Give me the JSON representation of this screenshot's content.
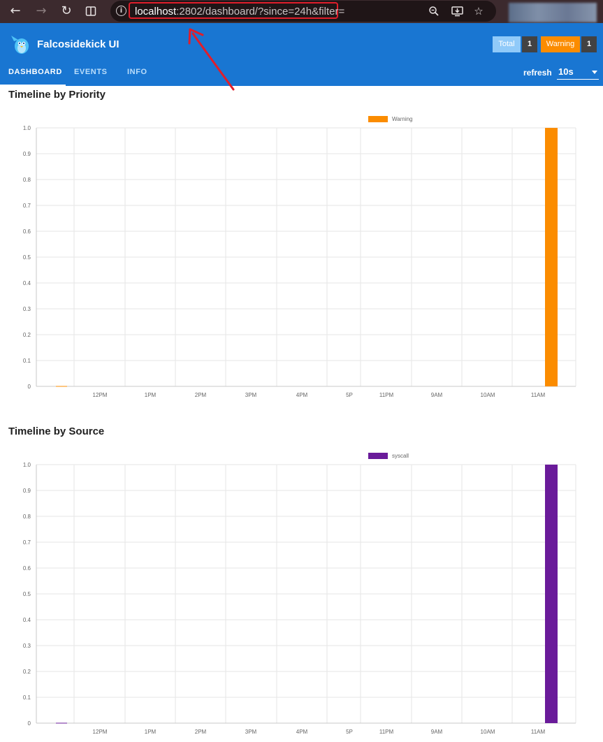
{
  "browser": {
    "url_host": "localhost",
    "url_rest": ":2802/dashboard/?since=24h&filter=",
    "back_icon": "arrow-left-icon",
    "forward_icon": "arrow-right-icon",
    "reload_icon": "reload-icon",
    "split_icon": "split-view-icon",
    "info_icon": "info-icon",
    "zoom_icon": "zoom-icon",
    "install_icon": "install-app-icon",
    "bookmark_icon": "star-icon"
  },
  "header": {
    "title": "Falcosidekick UI",
    "badges": {
      "total_label": "Total",
      "total_count": "1",
      "warning_label": "Warning",
      "warning_count": "1"
    },
    "tabs": [
      {
        "label": "DASHBOARD",
        "active": true
      },
      {
        "label": "EVENTS",
        "active": false
      },
      {
        "label": "INFO",
        "active": false
      }
    ],
    "refresh_label": "refresh",
    "refresh_value": "10s"
  },
  "chart_data": [
    {
      "type": "bar",
      "title": "Timeline by Priority",
      "categories": [
        "",
        "12PM",
        "1PM",
        "2PM",
        "3PM",
        "4PM",
        "5P",
        "11PM",
        "9AM",
        "10AM",
        "11AM",
        ""
      ],
      "series": [
        {
          "name": "Warning",
          "color": "#fb8c00",
          "values": [
            0,
            0,
            0,
            0,
            0,
            0,
            0,
            0,
            0,
            0,
            0,
            1
          ]
        }
      ],
      "ylim": [
        0,
        1.0
      ],
      "yticks": [
        "0",
        "0.1",
        "0.2",
        "0.3",
        "0.4",
        "0.5",
        "0.6",
        "0.7",
        "0.8",
        "0.9",
        "1.0"
      ],
      "grid": true,
      "legend": "top-center"
    },
    {
      "type": "bar",
      "title": "Timeline by Source",
      "categories": [
        "",
        "12PM",
        "1PM",
        "2PM",
        "3PM",
        "4PM",
        "5P",
        "11PM",
        "9AM",
        "10AM",
        "11AM",
        ""
      ],
      "series": [
        {
          "name": "syscall",
          "color": "#6a1b9a",
          "values": [
            0,
            0,
            0,
            0,
            0,
            0,
            0,
            0,
            0,
            0,
            0,
            1
          ]
        }
      ],
      "ylim": [
        0,
        1.0
      ],
      "yticks": [
        "0",
        "0.1",
        "0.2",
        "0.3",
        "0.4",
        "0.5",
        "0.6",
        "0.7",
        "0.8",
        "0.9",
        "1.0"
      ],
      "grid": true,
      "legend": "top-center"
    }
  ],
  "colors": {
    "app_bar": "#1976d2",
    "annotation": "#e01e2b"
  }
}
